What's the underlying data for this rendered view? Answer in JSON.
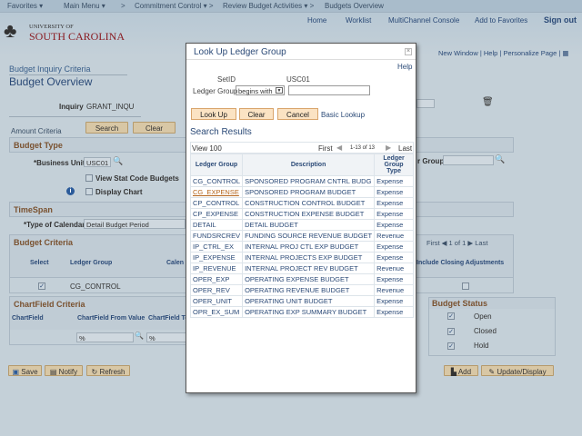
{
  "nav": {
    "favorites": "Favorites",
    "main_menu": "Main Menu",
    "commitment_control": "Commitment Control",
    "review_budget": "Review Budget Activities",
    "current": "Budgets Overview"
  },
  "header": {
    "logo_top": "UNIVERSITY OF",
    "logo_bottom": "SOUTH CAROLINA",
    "links": [
      "Home",
      "Worklist",
      "MultiChannel Console",
      "Add to Favorites"
    ],
    "sign_out": "Sign out"
  },
  "page_links": {
    "new_window": "New Window",
    "help": "Help",
    "personalize": "Personalize Page"
  },
  "page": {
    "breadcrumb": "Budget Inquiry Criteria",
    "title": "Budget Overview",
    "inquiry_label": "Inquiry",
    "inquiry_value": "GRANT_INQU",
    "amount_criteria": "Amount Criteria",
    "search": "Search",
    "clear": "Clear"
  },
  "budget_type": {
    "title": "Budget Type",
    "business_unit_label": "*Business Unit",
    "business_unit": "USC01",
    "view_stat": "View Stat Code Budgets",
    "display_chart": "Display Chart",
    "ledger_group_label": "r Group"
  },
  "timespan": {
    "title": "TimeSpan",
    "calendar_label": "*Type of Calendar",
    "calendar_value": "Detail Budget Period"
  },
  "budget_criteria": {
    "title": "Budget Criteria",
    "nav_first": "First",
    "nav_count": "1 of 1",
    "nav_last": "Last",
    "col_select": "Select",
    "col_ledger": "Ledger Group",
    "col_calendar": "Calen",
    "col_closing": "Include Closing Adjustments",
    "row_ledger": "CG_CONTROL"
  },
  "chartfield": {
    "title": "ChartField Criteria",
    "col_cf": "ChartField",
    "col_from": "ChartField From Value",
    "col_to": "ChartField To",
    "from": "%",
    "to": "%"
  },
  "budget_status": {
    "title": "Budget Status",
    "items": [
      "Open",
      "Closed",
      "Hold"
    ]
  },
  "footer": {
    "save": "Save",
    "notify": "Notify",
    "refresh": "Refresh",
    "add": "Add",
    "update": "Update/Display"
  },
  "modal": {
    "title": "Look Up Ledger Group",
    "help": "Help",
    "setid_label": "SetID",
    "setid": "USC01",
    "lg_label": "Ledger Group",
    "operator": "begins with",
    "lookup": "Look Up",
    "clear": "Clear",
    "cancel": "Cancel",
    "basic": "Basic Lookup",
    "results_title": "Search Results",
    "view": "View 100",
    "first": "First",
    "count": "1-13 of 13",
    "last": "Last",
    "columns": [
      "Ledger Group",
      "Description",
      "Ledger Group Type"
    ],
    "rows": [
      [
        "CG_CONTROL",
        "SPONSORED PROGRAM CNTRL BUDG",
        "Expense"
      ],
      [
        "CG_EXPENSE",
        "SPONSORED PROGRAM BUDGET",
        "Expense"
      ],
      [
        "CP_CONTROL",
        "CONSTRUCTION CONTROL BUDGET",
        "Expense"
      ],
      [
        "CP_EXPENSE",
        "CONSTRUCTION EXPENSE BUDGET",
        "Expense"
      ],
      [
        "DETAIL",
        "DETAIL BUDGET",
        "Expense"
      ],
      [
        "FUNDSRCREV",
        "FUNDING SOURCE REVENUE BUDGET",
        "Revenue"
      ],
      [
        "IP_CTRL_EX",
        "INTERNAL PROJ CTL EXP BUDGET",
        "Expense"
      ],
      [
        "IP_EXPENSE",
        "INTERNAL PROJECTS EXP BUDGET",
        "Expense"
      ],
      [
        "IP_REVENUE",
        "INTERNAL PROJECT REV BUDGET",
        "Revenue"
      ],
      [
        "OPER_EXP",
        "OPERATING EXPENSE BUDGET",
        "Expense"
      ],
      [
        "OPER_REV",
        "OPERATING REVENUE BUDGET",
        "Revenue"
      ],
      [
        "OPER_UNIT",
        "OPERATING UNIT BUDGET",
        "Expense"
      ],
      [
        "OPR_EX_SUM",
        "OPERATING EXP SUMMARY BUDGET",
        "Expense"
      ]
    ]
  }
}
